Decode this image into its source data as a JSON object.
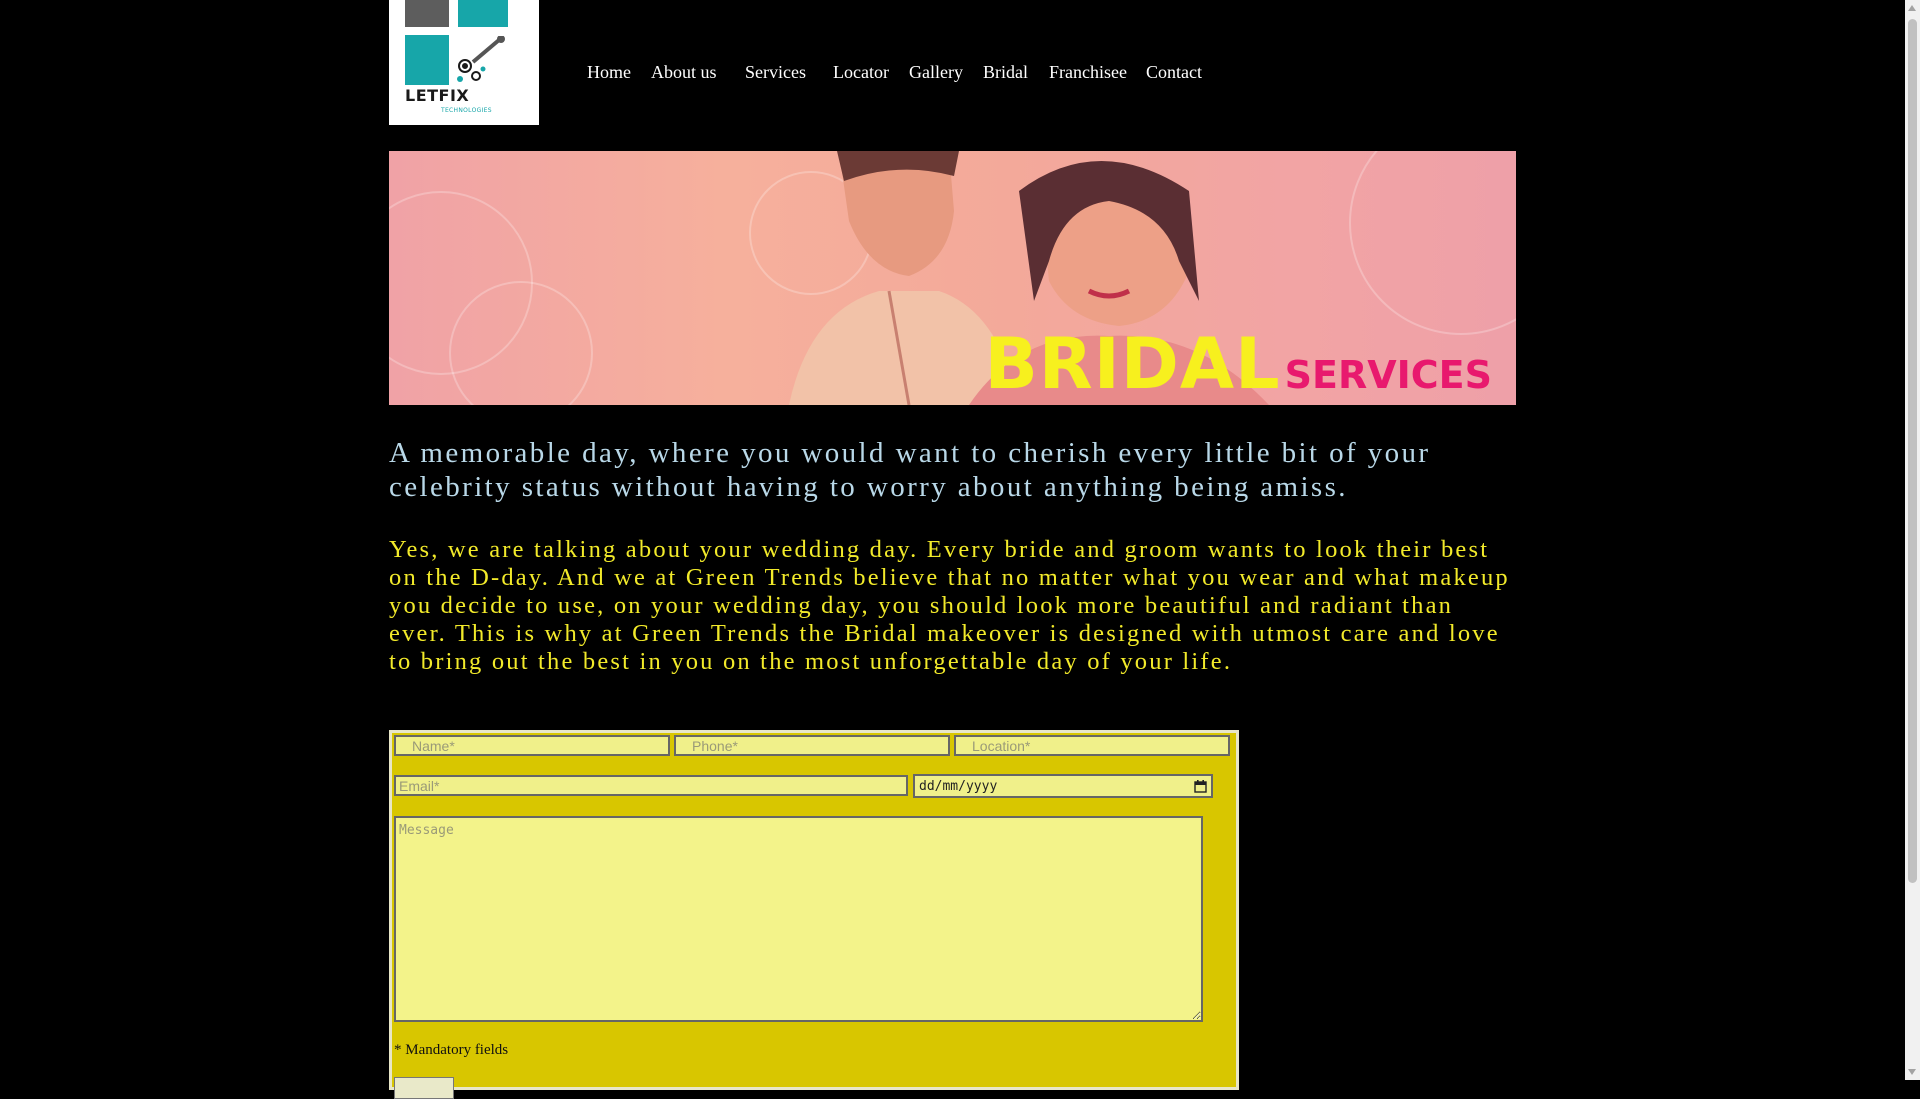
{
  "logo": {
    "brand": "LETFIX",
    "sub": "TECHNOLOGIES"
  },
  "nav": [
    {
      "id": "home",
      "label": "Home"
    },
    {
      "id": "about",
      "label": "About us"
    },
    {
      "id": "services",
      "label": "Services"
    },
    {
      "id": "locator",
      "label": "Locator"
    },
    {
      "id": "gallery",
      "label": "Gallery"
    },
    {
      "id": "bridal",
      "label": "Bridal"
    },
    {
      "id": "franchisee",
      "label": "Franchisee"
    },
    {
      "id": "contact",
      "label": "Contact"
    }
  ],
  "banner": {
    "title_big": "BRIDAL",
    "title_small": "SERVICES"
  },
  "content": {
    "lead": "A memorable day, where you would want to cherish every little bit of your celebrity status without having to worry about anything being amiss.",
    "body": "Yes, we are talking about your wedding day. Every bride and groom wants to look their best on the D-day. And we at Green Trends believe that no matter what you wear and what makeup you decide to use, on your wedding day, you should look more beautiful and radiant than ever. This is why at Green Trends the Bridal makeover is designed with utmost care and love to bring out the best in you on the most unforgettable day of your life."
  },
  "form": {
    "name_placeholder": "Name*",
    "phone_placeholder": "Phone*",
    "location_placeholder": "Location*",
    "email_placeholder": "Email*",
    "date_value": "dd/mm/yyyy",
    "message_placeholder": "Message",
    "mandatory_note": "* Mandatory fields"
  },
  "colors": {
    "background": "#000000",
    "lead_text": "#b9d8e8",
    "body_text": "#f2ea2a",
    "form_bg": "#d8c600",
    "logo_teal": "#17a6a9",
    "banner_yellow": "#f7f01e",
    "banner_pink": "#e8196e"
  },
  "icons": {
    "date_picker": "calendar-icon"
  }
}
